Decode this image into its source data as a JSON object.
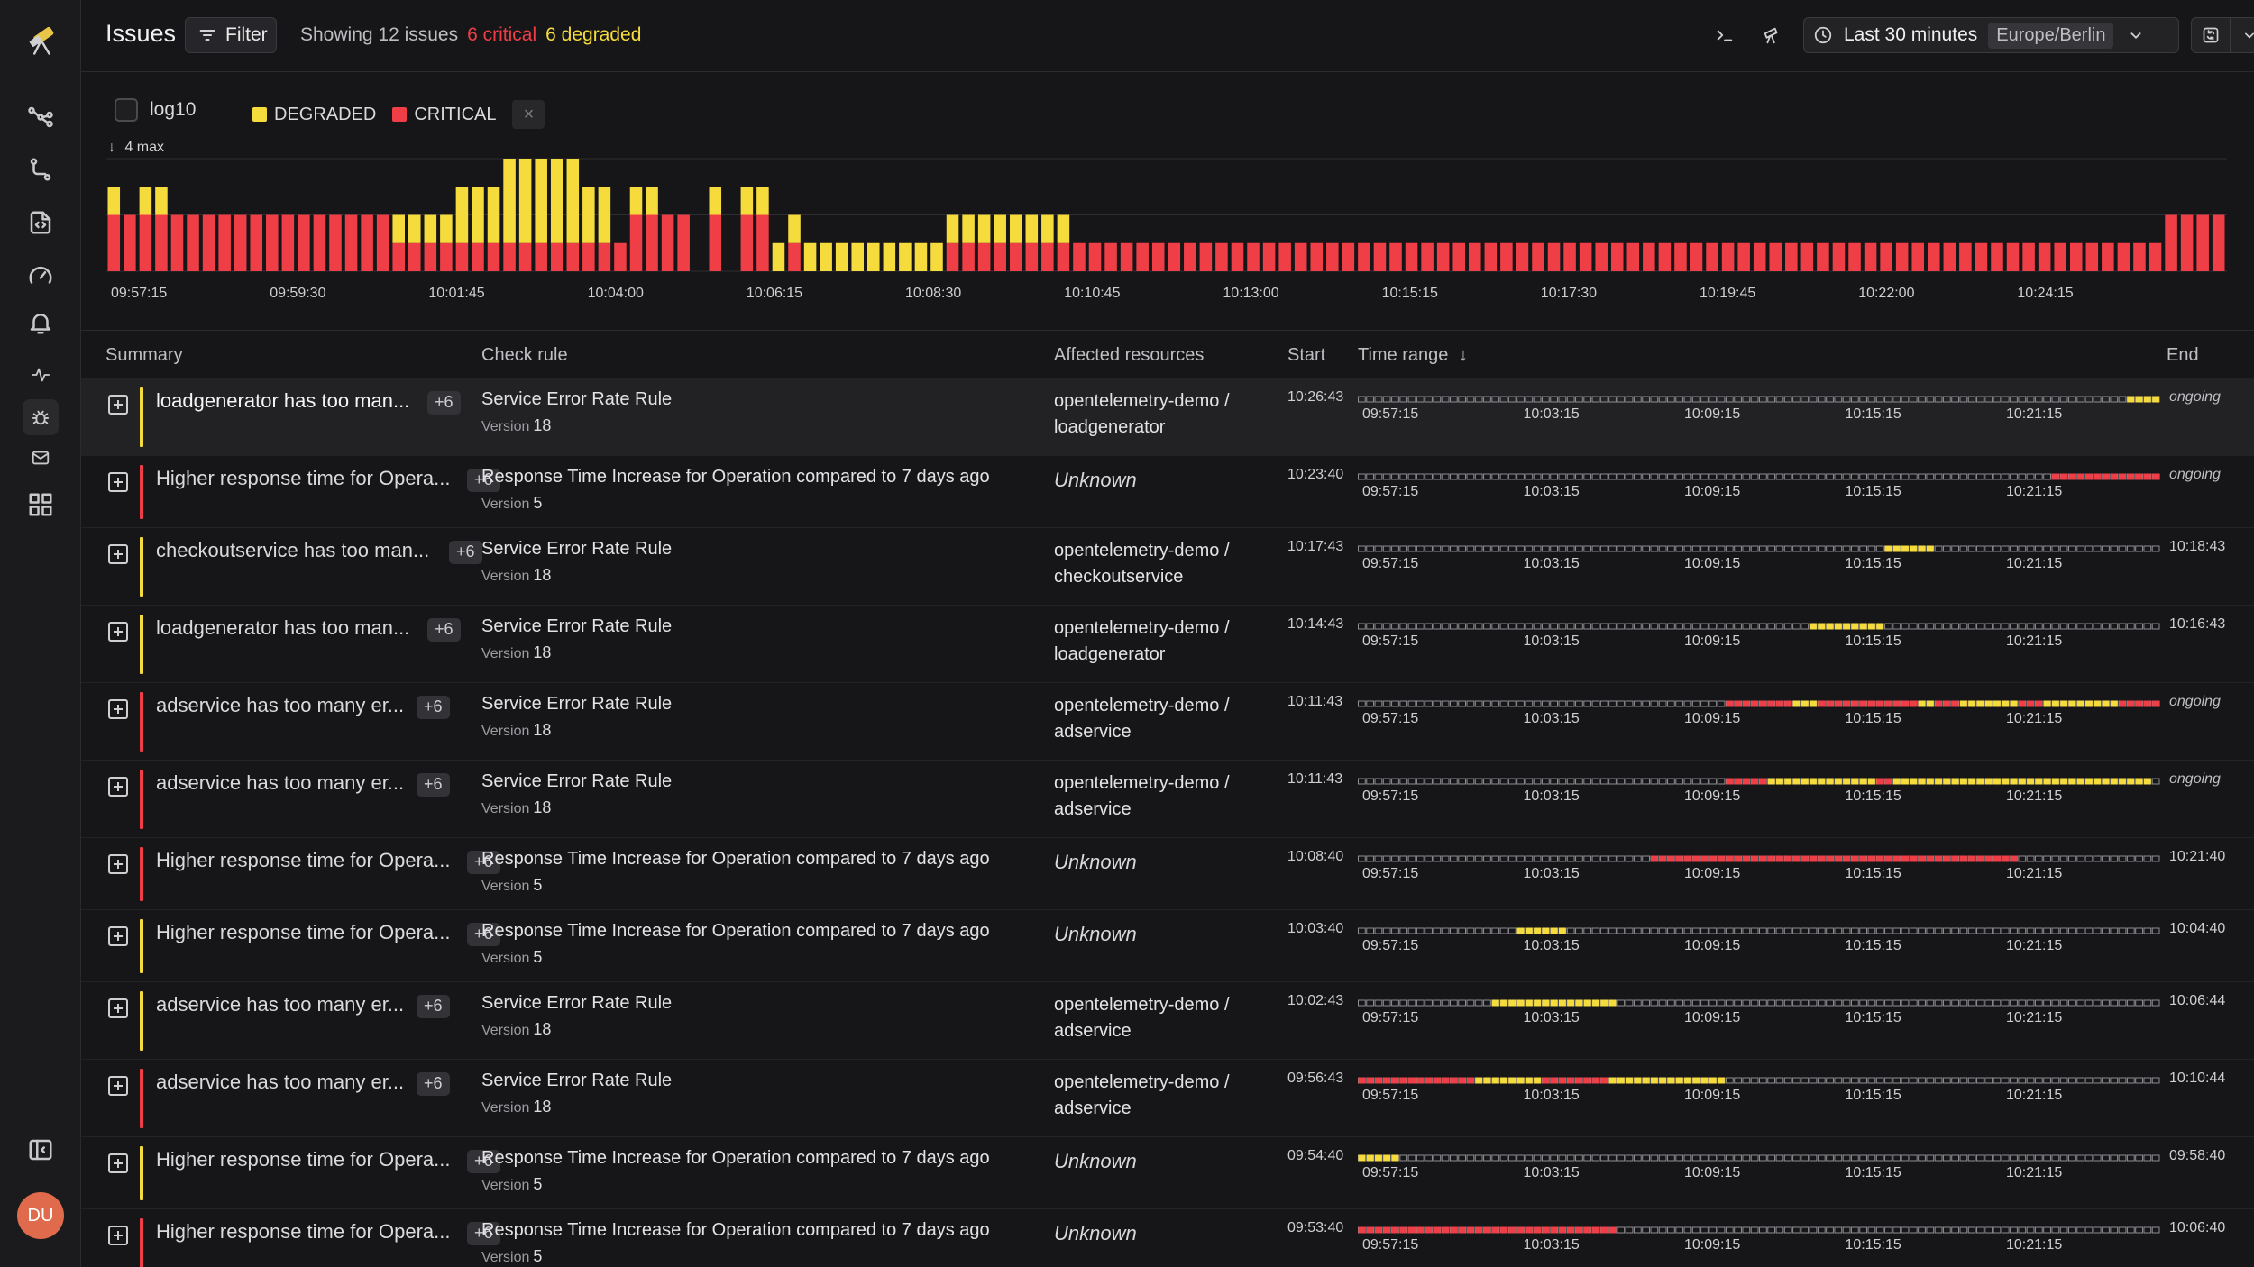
{
  "sidebar": {
    "icons": [
      "logo-icon",
      "topology-icon",
      "workflow-icon",
      "code-icon",
      "gauge-icon",
      "bell-icon",
      "pulse-icon",
      "bug-icon",
      "mail-icon",
      "grid-icon",
      "sidebar-toggle-icon"
    ],
    "avatar": "DU"
  },
  "header": {
    "title": "Issues",
    "filter_label": "Filter",
    "showing": "Showing 12 issues",
    "critical": "6 critical",
    "degraded": "6 degraded",
    "time_range": "Last 30 minutes",
    "timezone": "Europe/Berlin"
  },
  "chart_controls": {
    "log_label": "log10",
    "log_checked": false,
    "legend": [
      {
        "name": "DEGRADED",
        "color": "#f5dc3c"
      },
      {
        "name": "CRITICAL",
        "color": "#ef3e46"
      }
    ],
    "clear_icon": "×",
    "max_label": "4 max"
  },
  "chart_data": {
    "type": "bar",
    "stacked": true,
    "ylim": [
      0,
      4
    ],
    "x_ticks": [
      "09:57:15",
      "09:59:30",
      "10:01:45",
      "10:04:00",
      "10:06:15",
      "10:08:30",
      "10:10:45",
      "10:13:00",
      "10:15:15",
      "10:17:30",
      "10:19:45",
      "10:22:00",
      "10:24:15"
    ],
    "series": [
      {
        "name": "CRITICAL",
        "color": "#ef3e46",
        "values": [
          2,
          2,
          2,
          2,
          2,
          2,
          2,
          2,
          2,
          2,
          2,
          2,
          2,
          2,
          2,
          2,
          2,
          2,
          1,
          1,
          1,
          1,
          1,
          1,
          1,
          1,
          1,
          1,
          1,
          1,
          1,
          1,
          1,
          2,
          2,
          2,
          2,
          0,
          2,
          0,
          2,
          2,
          0,
          1,
          0,
          0,
          0,
          0,
          0,
          0,
          0,
          0,
          0,
          1,
          1,
          1,
          1,
          1,
          1,
          1,
          1,
          1,
          1,
          1,
          1,
          1,
          1,
          1,
          1,
          1,
          1,
          1,
          1,
          1,
          1,
          1,
          1,
          1,
          1,
          1,
          1,
          1,
          1,
          1,
          1,
          1,
          1,
          1,
          1,
          1,
          1,
          1,
          1,
          1,
          1,
          1,
          1,
          1,
          1,
          1,
          1,
          1,
          1,
          1,
          1,
          1,
          1,
          1,
          1,
          1,
          1,
          1,
          1,
          1,
          1,
          1,
          1,
          1,
          1,
          1,
          1,
          1,
          1,
          1,
          1,
          1,
          1,
          1,
          1,
          1,
          2,
          2,
          2,
          2
        ]
      },
      {
        "name": "DEGRADED",
        "color": "#f5dc3c",
        "values": [
          1,
          0,
          1,
          1,
          0,
          0,
          0,
          0,
          0,
          0,
          0,
          0,
          0,
          0,
          0,
          0,
          0,
          0,
          1,
          1,
          1,
          1,
          2,
          2,
          2,
          3,
          3,
          3,
          3,
          3,
          2,
          2,
          0,
          1,
          1,
          0,
          0,
          0,
          1,
          0,
          1,
          1,
          1,
          1,
          1,
          1,
          1,
          1,
          1,
          1,
          1,
          1,
          1,
          1,
          1,
          1,
          1,
          1,
          1,
          1,
          1,
          0,
          0,
          0,
          0,
          0,
          0,
          0,
          0,
          0,
          0,
          0,
          0,
          0,
          0,
          0,
          0,
          0,
          0,
          0,
          0,
          0,
          0,
          0,
          0,
          0,
          0,
          0,
          0,
          0,
          0,
          0,
          0,
          0,
          0,
          0,
          0,
          0,
          0,
          0,
          0,
          0,
          0,
          0,
          0,
          0,
          0,
          0,
          0,
          0,
          0,
          0,
          0,
          0,
          0,
          0,
          0,
          0,
          0,
          0,
          0,
          0,
          0,
          0,
          0,
          0,
          0,
          0,
          0,
          0,
          0,
          0,
          0,
          0
        ]
      }
    ]
  },
  "table": {
    "columns": [
      "Summary",
      "Check rule",
      "Affected resources",
      "Start",
      "Time range",
      "End"
    ],
    "timeline_ticks": [
      "09:57:15",
      "10:03:15",
      "10:09:15",
      "10:15:15",
      "10:21:15"
    ],
    "rows": [
      {
        "summary": "loadgenerator has too man...",
        "badge": "+6",
        "severity": "degraded",
        "rule": "Service Error Rate Rule",
        "version_label": "Version",
        "version": "18",
        "resource1": "opentelemetry-demo /",
        "resource2": "loadgenerator",
        "unknown": false,
        "start": "10:26:43",
        "end": "ongoing"
      },
      {
        "summary": "Higher response time for Opera...",
        "badge": "+6",
        "severity": "critical",
        "rule": "Response Time Increase for Operation compared to 7 days ago",
        "version_label": "Version",
        "version": "5",
        "resource1": "Unknown",
        "resource2": "",
        "unknown": true,
        "start": "10:23:40",
        "end": "ongoing"
      },
      {
        "summary": "checkoutservice has too man...",
        "badge": "+6",
        "severity": "degraded",
        "rule": "Service Error Rate Rule",
        "version_label": "Version",
        "version": "18",
        "resource1": "opentelemetry-demo /",
        "resource2": "checkoutservice",
        "unknown": false,
        "start": "10:17:43",
        "end": "10:18:43"
      },
      {
        "summary": "loadgenerator has too man...",
        "badge": "+6",
        "severity": "degraded",
        "rule": "Service Error Rate Rule",
        "version_label": "Version",
        "version": "18",
        "resource1": "opentelemetry-demo /",
        "resource2": "loadgenerator",
        "unknown": false,
        "start": "10:14:43",
        "end": "10:16:43"
      },
      {
        "summary": "adservice has too many er...",
        "badge": "+6",
        "severity": "critical",
        "rule": "Service Error Rate Rule",
        "version_label": "Version",
        "version": "18",
        "resource1": "opentelemetry-demo /",
        "resource2": "adservice",
        "unknown": false,
        "start": "10:11:43",
        "end": "ongoing"
      },
      {
        "summary": "adservice has too many er...",
        "badge": "+6",
        "severity": "critical",
        "rule": "Service Error Rate Rule",
        "version_label": "Version",
        "version": "18",
        "resource1": "opentelemetry-demo /",
        "resource2": "adservice",
        "unknown": false,
        "start": "10:11:43",
        "end": "ongoing"
      },
      {
        "summary": "Higher response time for Opera...",
        "badge": "+6",
        "severity": "critical",
        "rule": "Response Time Increase for Operation compared to 7 days ago",
        "version_label": "Version",
        "version": "5",
        "resource1": "Unknown",
        "resource2": "",
        "unknown": true,
        "start": "10:08:40",
        "end": "10:21:40"
      },
      {
        "summary": "Higher response time for Opera...",
        "badge": "+6",
        "severity": "degraded",
        "rule": "Response Time Increase for Operation compared to 7 days ago",
        "version_label": "Version",
        "version": "5",
        "resource1": "Unknown",
        "resource2": "",
        "unknown": true,
        "start": "10:03:40",
        "end": "10:04:40"
      },
      {
        "summary": "adservice has too many er...",
        "badge": "+6",
        "severity": "degraded",
        "rule": "Service Error Rate Rule",
        "version_label": "Version",
        "version": "18",
        "resource1": "opentelemetry-demo /",
        "resource2": "adservice",
        "unknown": false,
        "start": "10:02:43",
        "end": "10:06:44"
      },
      {
        "summary": "adservice has too many er...",
        "badge": "+6",
        "severity": "critical",
        "rule": "Service Error Rate Rule",
        "version_label": "Version",
        "version": "18",
        "resource1": "opentelemetry-demo /",
        "resource2": "adservice",
        "unknown": false,
        "start": "09:56:43",
        "end": "10:10:44"
      },
      {
        "summary": "Higher response time for Opera...",
        "badge": "+6",
        "severity": "degraded",
        "rule": "Response Time Increase for Operation compared to 7 days ago",
        "version_label": "Version",
        "version": "5",
        "resource1": "Unknown",
        "resource2": "",
        "unknown": true,
        "start": "09:54:40",
        "end": "09:58:40"
      },
      {
        "summary": "Higher response time for Opera...",
        "badge": "+6",
        "severity": "critical",
        "rule": "Response Time Increase for Operation compared to 7 days ago",
        "version_label": "Version",
        "version": "5",
        "resource1": "Unknown",
        "resource2": "",
        "unknown": true,
        "start": "09:53:40",
        "end": "10:06:40"
      }
    ]
  },
  "colors": {
    "critical": "#ef3e46",
    "degraded": "#f5dc3c",
    "empty": "#d0d0d4"
  }
}
